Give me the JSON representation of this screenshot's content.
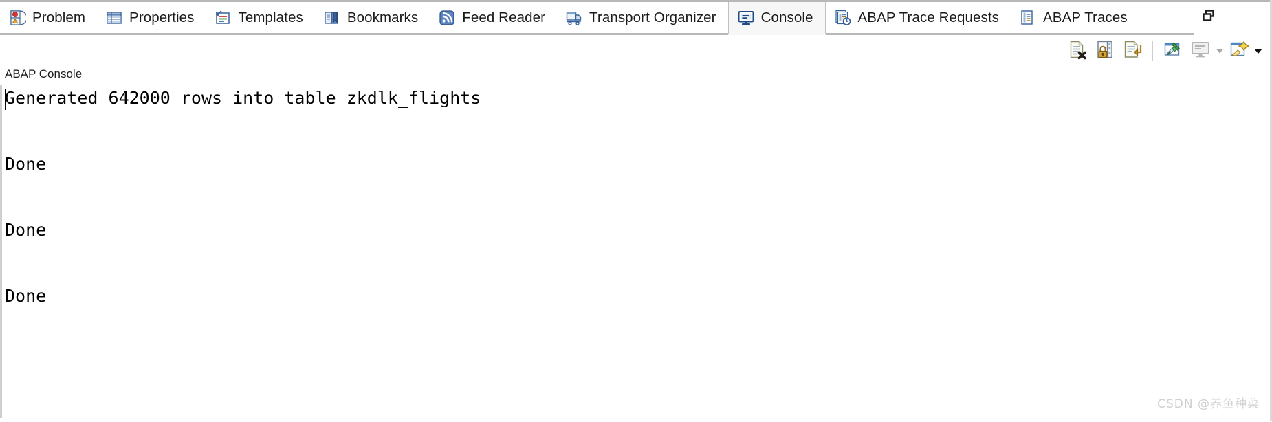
{
  "window": {
    "restore_icon": "restore-window-icon"
  },
  "tabs": [
    {
      "label": "Problem",
      "icon": "problem-icon",
      "active": false
    },
    {
      "label": "Properties",
      "icon": "properties-icon",
      "active": false
    },
    {
      "label": "Templates",
      "icon": "templates-icon",
      "active": false
    },
    {
      "label": "Bookmarks",
      "icon": "bookmarks-icon",
      "active": false
    },
    {
      "label": "Feed Reader",
      "icon": "feed-reader-icon",
      "active": false
    },
    {
      "label": "Transport Organizer",
      "icon": "transport-organizer-icon",
      "active": false
    },
    {
      "label": "Console",
      "icon": "console-icon",
      "active": true
    },
    {
      "label": "ABAP Trace Requests",
      "icon": "abap-trace-requests-icon",
      "active": false
    },
    {
      "label": "ABAP Traces",
      "icon": "abap-traces-icon",
      "active": false
    }
  ],
  "toolbar": {
    "buttons": [
      {
        "name": "clear-console-button",
        "tooltip": "Clear Console"
      },
      {
        "name": "lock-scroll-button",
        "tooltip": "Scroll Lock"
      },
      {
        "name": "word-wrap-button",
        "tooltip": "Word Wrap"
      },
      {
        "name": "pin-console-button",
        "tooltip": "Pin Console"
      },
      {
        "name": "display-console-button",
        "tooltip": "Display Selected Console",
        "disabled": true,
        "has_caret": true
      },
      {
        "name": "open-console-button",
        "tooltip": "Open Console",
        "has_caret": true
      }
    ]
  },
  "console": {
    "title": "ABAP Console",
    "lines": [
      "Generated 642000 rows into table zkdlk_flights",
      "",
      "",
      "Done",
      "",
      "",
      "Done",
      "",
      "",
      "Done"
    ]
  },
  "watermark": {
    "text": "CSDN @养鱼种菜"
  },
  "colors": {
    "tab_border": "#b8b8b8",
    "active_tab_bg": "#f7f7f7",
    "console_bg": "#ffffff",
    "text": "#1b1b1b",
    "watermark": "#cfcfcf"
  }
}
